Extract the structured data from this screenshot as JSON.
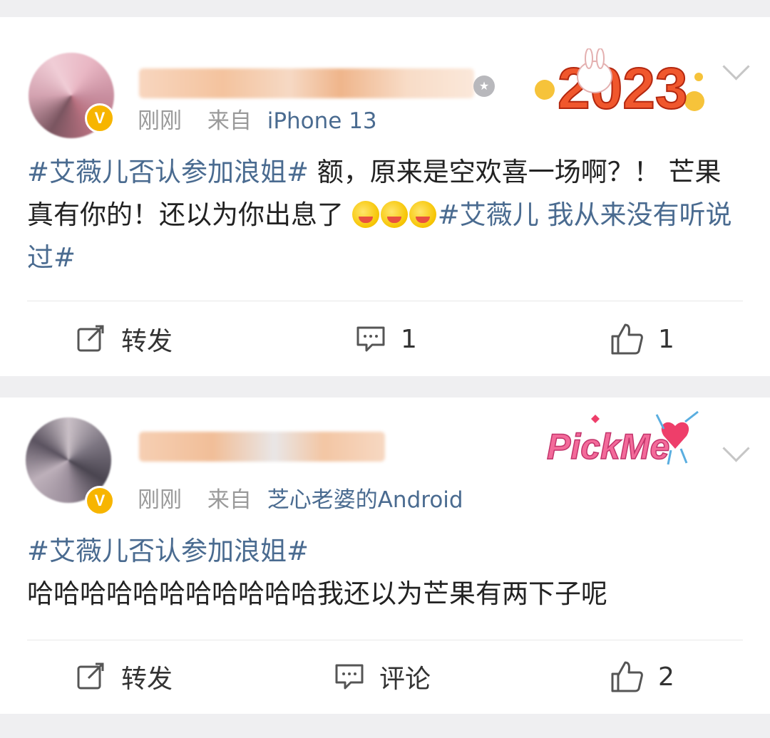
{
  "posts": [
    {
      "time": "刚刚",
      "source_prefix": "来自",
      "source": "iPhone 13",
      "decoration_text": "2023",
      "content": {
        "topic1": "#艾薇儿否认参加浪姐#",
        "text": " 额，原来是空欢喜一场啊？！ 芒果真有你的！还以为你出息了 ",
        "topic2": "#艾薇儿 我从来没有听说过#"
      },
      "actions": {
        "repost_label": "转发",
        "comment_label": "1",
        "like_label": "1"
      }
    },
    {
      "time": "刚刚",
      "source_prefix": "来自",
      "source": "芝心老婆的Android",
      "decoration_text": "PickMe",
      "content": {
        "topic1": "#艾薇儿否认参加浪姐#",
        "text": "哈哈哈哈哈哈哈哈哈哈哈我还以为芒果有两下子呢"
      },
      "actions": {
        "repost_label": "转发",
        "comment_label": "评论",
        "like_label": "2"
      }
    }
  ],
  "colors": {
    "background": "#efeff1",
    "card": "#ffffff",
    "topic_link": "#4a6b90",
    "meta_text": "#9a9a9a",
    "verified_badge": "#f7b500"
  },
  "icons": {
    "repost": "repost-icon",
    "comment": "comment-icon",
    "like": "thumbs-up-icon",
    "more": "chevron-down-icon",
    "verified": "verified-badge-icon"
  }
}
